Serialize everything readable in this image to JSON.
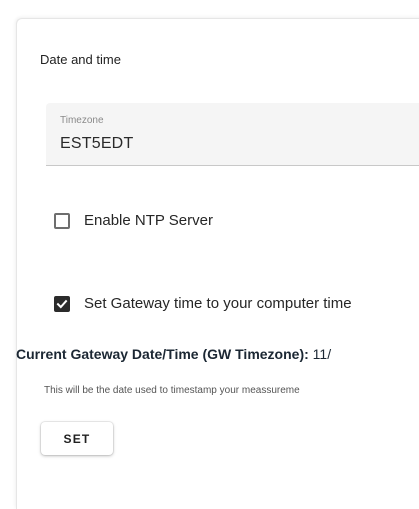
{
  "section": {
    "title": "Date and time"
  },
  "timezone": {
    "label": "Timezone",
    "value": "EST5EDT"
  },
  "ntp": {
    "label": "Enable NTP Server",
    "checked": false
  },
  "gateway_time": {
    "label": "Set Gateway time to your computer time",
    "checked": true
  },
  "current": {
    "label": "Current Gateway Date/Time (GW Timezone):",
    "value": "11/"
  },
  "hint": {
    "text": "This will be the date used to timestamp your meassureme"
  },
  "actions": {
    "set_label": "SET"
  },
  "colors": {
    "checkbox_checked": "#2b2b2b",
    "field_background": "#f5f5f5"
  }
}
